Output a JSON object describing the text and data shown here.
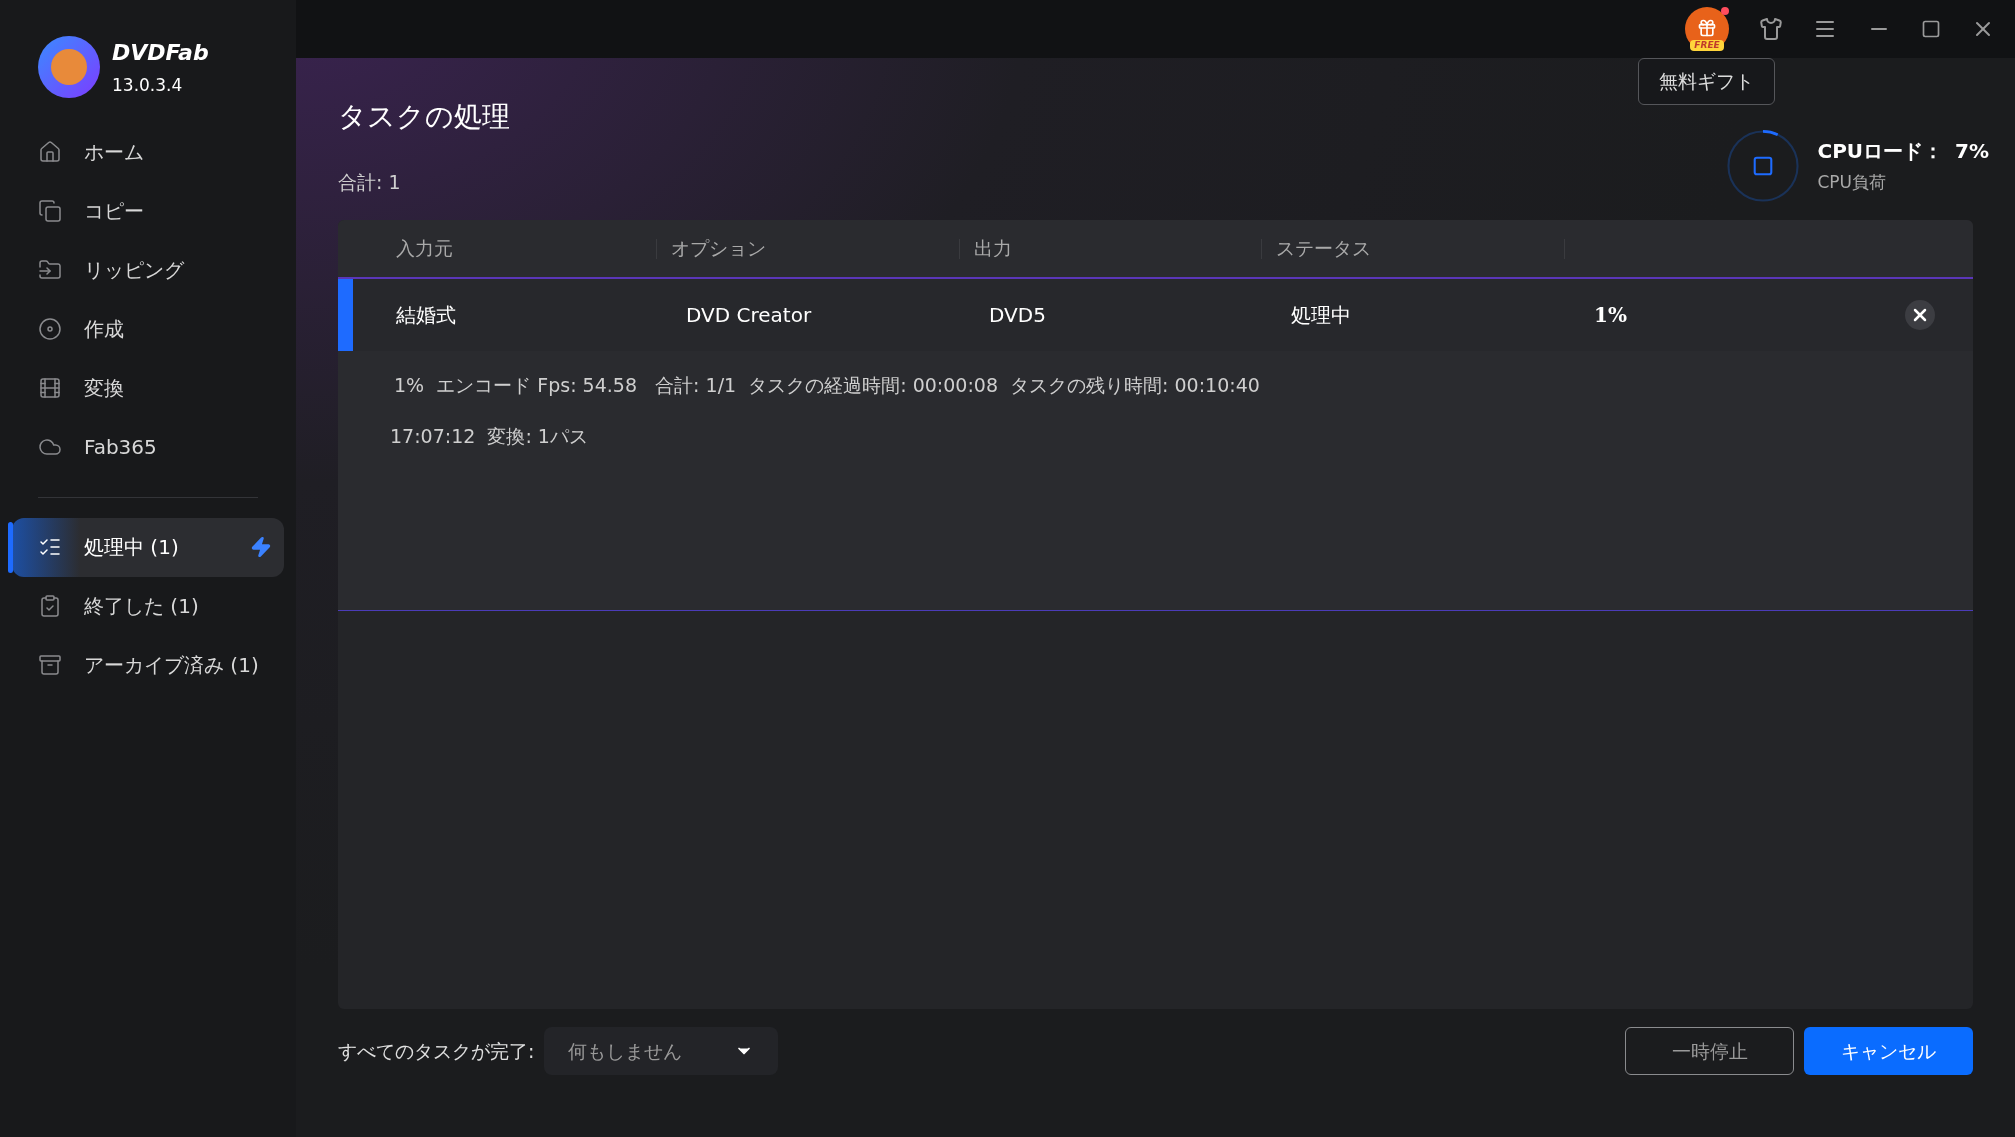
{
  "app": {
    "name": "DVDFab",
    "version": "13.0.3.4"
  },
  "sidebar": {
    "items": [
      {
        "label": "ホーム",
        "selected": false
      },
      {
        "label": "コピー",
        "selected": false
      },
      {
        "label": "リッピング",
        "selected": false
      },
      {
        "label": "作成",
        "selected": false
      },
      {
        "label": "変換",
        "selected": false
      },
      {
        "label": "Fab365",
        "selected": false
      }
    ],
    "task_items": [
      {
        "label": "処理中 (1)",
        "selected": true,
        "boost": true
      },
      {
        "label": "終了した (1)",
        "selected": false,
        "boost": false
      },
      {
        "label": "アーカイブ済み (1)",
        "selected": false,
        "boost": false
      }
    ]
  },
  "title_bar": {
    "free_badge": "FREE",
    "notification": true,
    "tooltip": "無料ギフト"
  },
  "cpu": {
    "label": "CPUロード：",
    "value": "7%",
    "caption": "CPU負荷",
    "level": 0.07
  },
  "page": {
    "title": "タスクの処理",
    "total": "合計: 1"
  },
  "table": {
    "columns": [
      "入力元",
      "オプション",
      "出力",
      "ステータス"
    ],
    "rows": [
      {
        "cells": [
          "結婚式",
          "DVD Creator",
          "DVD5",
          "処理中",
          "1%"
        ],
        "selected": true,
        "details": [
          "1%  エンコード Fps: 54.58   合計: 1/1  タスクの経過時間: 00:00:08  タスクの残り時間: 00:10:40",
          "17:07:12  変換: 1パス"
        ]
      }
    ]
  },
  "footer": {
    "label": "すべてのタスクが完了:",
    "dropdown": "何もしません",
    "buttons": [
      {
        "label": "一時停止",
        "kind": "outline"
      },
      {
        "label": "キャンセル",
        "kind": "primary"
      }
    ]
  }
}
